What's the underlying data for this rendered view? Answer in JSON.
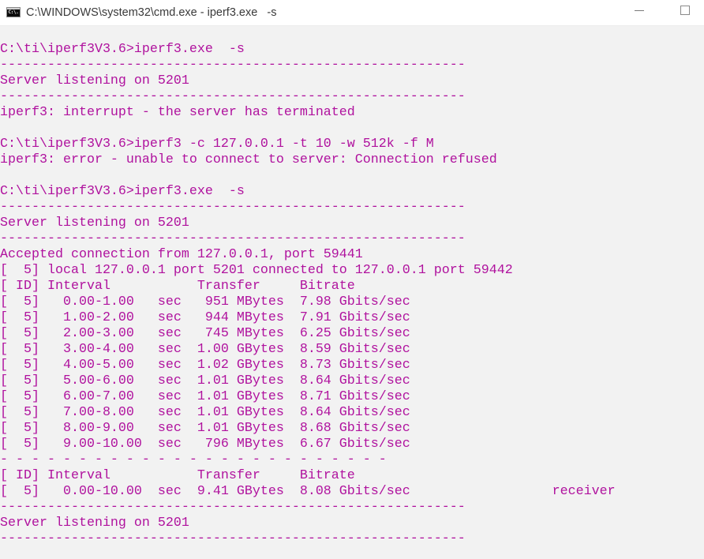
{
  "window": {
    "title": "C:\\WINDOWS\\system32\\cmd.exe - iperf3.exe   -s",
    "icon": "console-icon",
    "icon_label": "C:\\.",
    "buttons": [
      "minimize",
      "maximize"
    ]
  },
  "colors": {
    "foreground": "#b0129e",
    "background": "#f2f2f2",
    "titlebar": "#ffffff"
  },
  "console": {
    "lines": [
      "",
      "C:\\ti\\iperf3V3.6>iperf3.exe  -s",
      "-----------------------------------------------------------",
      "Server listening on 5201",
      "-----------------------------------------------------------",
      "iperf3: interrupt - the server has terminated",
      "",
      "C:\\ti\\iperf3V3.6>iperf3 -c 127.0.0.1 -t 10 -w 512k -f M",
      "iperf3: error - unable to connect to server: Connection refused",
      "",
      "C:\\ti\\iperf3V3.6>iperf3.exe  -s",
      "-----------------------------------------------------------",
      "Server listening on 5201",
      "-----------------------------------------------------------",
      "Accepted connection from 127.0.0.1, port 59441",
      "[  5] local 127.0.0.1 port 5201 connected to 127.0.0.1 port 59442",
      "[ ID] Interval           Transfer     Bitrate",
      "[  5]   0.00-1.00   sec   951 MBytes  7.98 Gbits/sec",
      "[  5]   1.00-2.00   sec   944 MBytes  7.91 Gbits/sec",
      "[  5]   2.00-3.00   sec   745 MBytes  6.25 Gbits/sec",
      "[  5]   3.00-4.00   sec  1.00 GBytes  8.59 Gbits/sec",
      "[  5]   4.00-5.00   sec  1.02 GBytes  8.73 Gbits/sec",
      "[  5]   5.00-6.00   sec  1.01 GBytes  8.64 Gbits/sec",
      "[  5]   6.00-7.00   sec  1.01 GBytes  8.71 Gbits/sec",
      "[  5]   7.00-8.00   sec  1.01 GBytes  8.64 Gbits/sec",
      "[  5]   8.00-9.00   sec  1.01 GBytes  8.68 Gbits/sec",
      "[  5]   9.00-10.00  sec   796 MBytes  6.67 Gbits/sec",
      "- - - - - - - - - - - - - - - - - - - - - - - - -",
      "[ ID] Interval           Transfer     Bitrate",
      "[  5]   0.00-10.00  sec  9.41 GBytes  8.08 Gbits/sec                  receiver",
      "-----------------------------------------------------------",
      "Server listening on 5201",
      "-----------------------------------------------------------"
    ]
  },
  "iperf_results": {
    "header": [
      "ID",
      "Interval",
      "Transfer",
      "Bitrate"
    ],
    "intervals": [
      {
        "id": "5",
        "interval": "0.00-1.00 sec",
        "transfer": "951 MBytes",
        "bitrate": "7.98 Gbits/sec"
      },
      {
        "id": "5",
        "interval": "1.00-2.00 sec",
        "transfer": "944 MBytes",
        "bitrate": "7.91 Gbits/sec"
      },
      {
        "id": "5",
        "interval": "2.00-3.00 sec",
        "transfer": "745 MBytes",
        "bitrate": "6.25 Gbits/sec"
      },
      {
        "id": "5",
        "interval": "3.00-4.00 sec",
        "transfer": "1.00 GBytes",
        "bitrate": "8.59 Gbits/sec"
      },
      {
        "id": "5",
        "interval": "4.00-5.00 sec",
        "transfer": "1.02 GBytes",
        "bitrate": "8.73 Gbits/sec"
      },
      {
        "id": "5",
        "interval": "5.00-6.00 sec",
        "transfer": "1.01 GBytes",
        "bitrate": "8.64 Gbits/sec"
      },
      {
        "id": "5",
        "interval": "6.00-7.00 sec",
        "transfer": "1.01 GBytes",
        "bitrate": "8.71 Gbits/sec"
      },
      {
        "id": "5",
        "interval": "7.00-8.00 sec",
        "transfer": "1.01 GBytes",
        "bitrate": "8.64 Gbits/sec"
      },
      {
        "id": "5",
        "interval": "8.00-9.00 sec",
        "transfer": "1.01 GBytes",
        "bitrate": "8.68 Gbits/sec"
      },
      {
        "id": "5",
        "interval": "9.00-10.00 sec",
        "transfer": "796 MBytes",
        "bitrate": "6.67 Gbits/sec"
      }
    ],
    "summary": {
      "id": "5",
      "interval": "0.00-10.00 sec",
      "transfer": "9.41 GBytes",
      "bitrate": "8.08 Gbits/sec",
      "role": "receiver"
    }
  }
}
